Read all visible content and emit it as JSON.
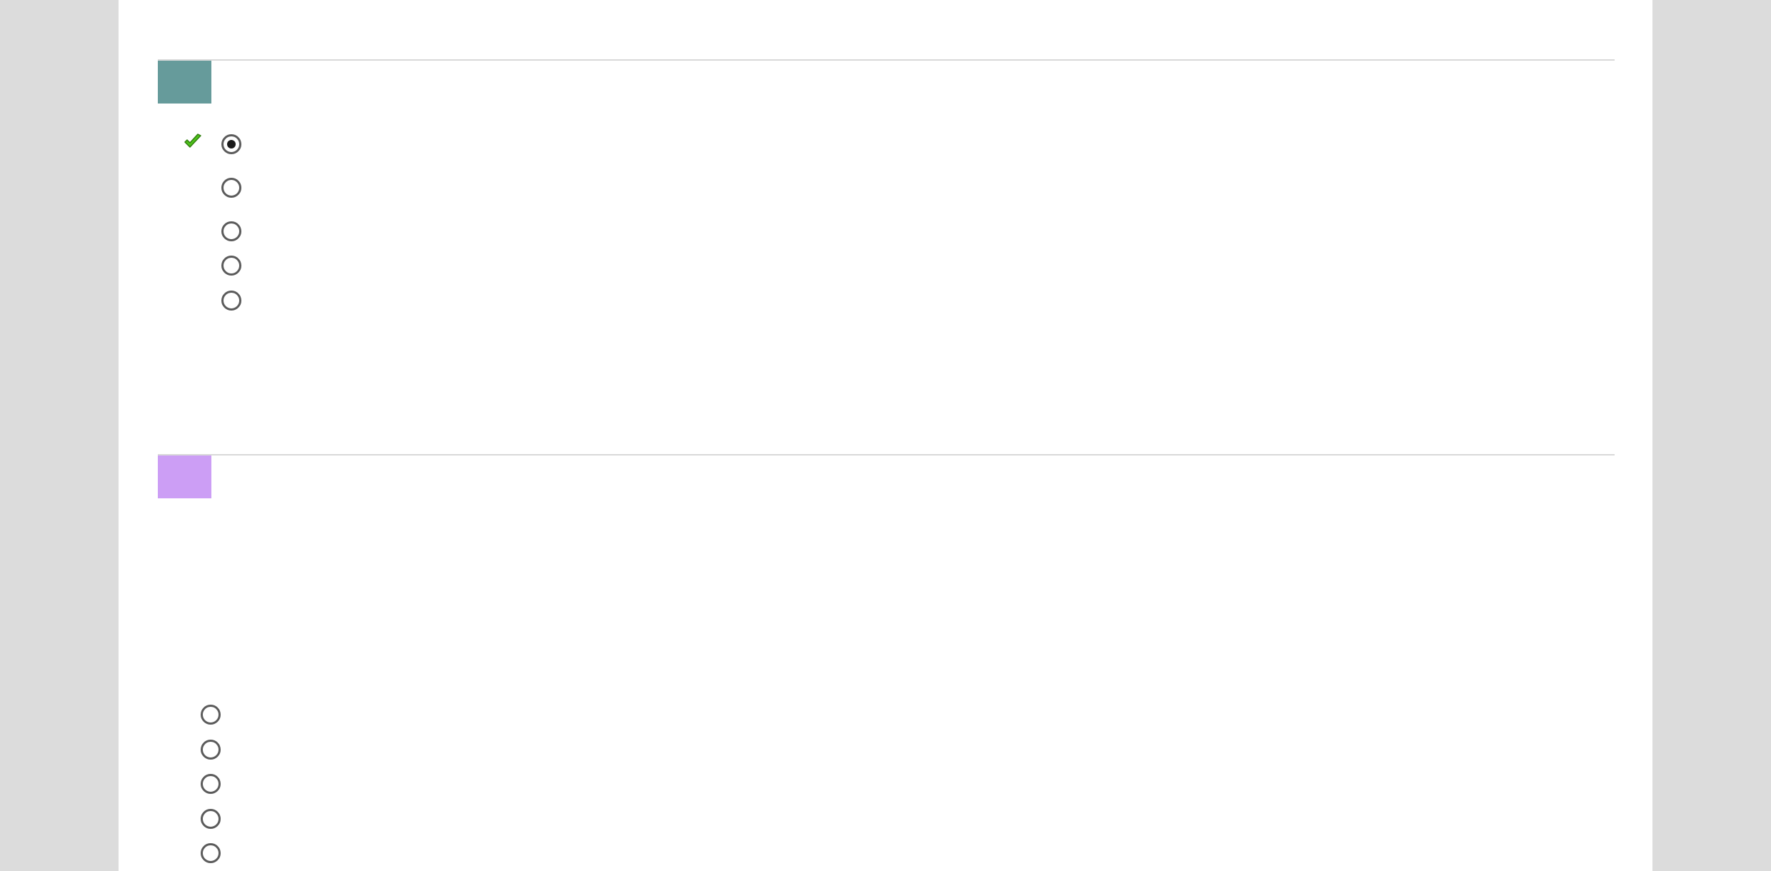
{
  "colors": {
    "page_background": "#dcdcdc",
    "sheet_background": "#ffffff",
    "divider": "#d9d9d9",
    "check_mark": "#4ec21b"
  },
  "questions": [
    {
      "number": "",
      "tab_color": "#669b9b",
      "correct_marker_icon": "green-check-icon",
      "options": [
        {
          "label": "",
          "selected": true
        },
        {
          "label": "",
          "selected": false
        },
        {
          "label": "",
          "selected": false
        },
        {
          "label": "",
          "selected": false
        },
        {
          "label": "",
          "selected": false
        }
      ]
    },
    {
      "number": "",
      "tab_color": "#cc9ef5",
      "options": [
        {
          "label": "",
          "selected": false
        },
        {
          "label": "",
          "selected": false
        },
        {
          "label": "",
          "selected": false
        },
        {
          "label": "",
          "selected": false
        },
        {
          "label": "",
          "selected": false
        }
      ]
    }
  ]
}
